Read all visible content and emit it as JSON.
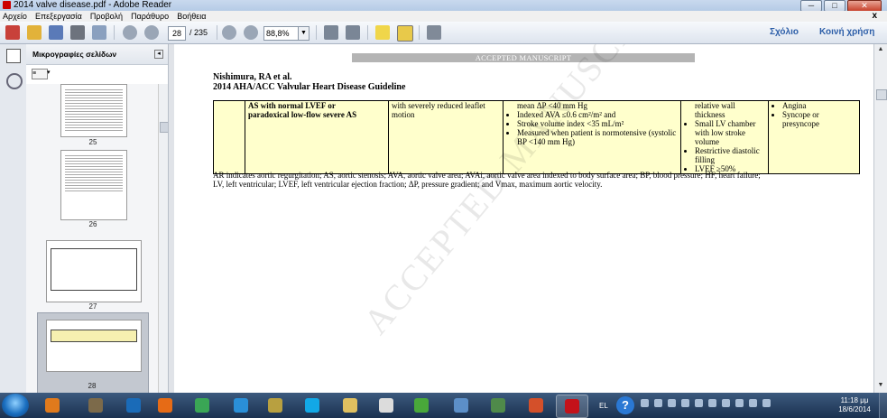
{
  "window": {
    "title": "2014 valve disease.pdf - Adobe Reader",
    "minimize": "─",
    "maximize": "□",
    "close": "✕",
    "doc_close": "x"
  },
  "menu": [
    "Αρχείο",
    "Επεξεργασία",
    "Προβολή",
    "Παράθυρο",
    "Βοήθεια"
  ],
  "toolbar": {
    "page_number": "28",
    "page_total": "/ 235",
    "zoom": "88,8%",
    "comment_link": "Σχόλιο",
    "share_link": "Κοινή χρήση"
  },
  "sidebar": {
    "title": "Μικρογραφίες σελίδων",
    "thumbnails": [
      {
        "label": "25"
      },
      {
        "label": "26"
      },
      {
        "label": "27"
      },
      {
        "label": "28"
      }
    ]
  },
  "document": {
    "banner": "ACCEPTED MANUSCRIPT",
    "author": "Nishimura, RA et al.",
    "guideline": "2014 AHA/ACC Valvular Heart Disease Guideline",
    "table_row": {
      "c2_line1": "AS with normal LVEF or",
      "c2_line2": "paradoxical low-flow severe AS",
      "c3": "with severely reduced leaflet motion",
      "c4_head": "mean ΔP <40 mm Hg",
      "c4_items": [
        "Indexed AVA ≤0.6 cm²/m² and",
        "Stroke volume index <35 mL/m²",
        "Measured when patient is normotensive (systolic BP <140 mm Hg)"
      ],
      "c5_head": "relative wall thickness",
      "c5_items": [
        "Small LV chamber with low stroke volume",
        "Restrictive diastolic filling",
        "LVEF ≥50%"
      ],
      "c6_items": [
        "Angina",
        "Syncope or presyncope"
      ]
    },
    "footnote_line1": "AR indicates aortic regurgitation; AS, aortic stenosis; AVA, aortic valve area; AVAi, aortic valve area indexed to body surface area; BP, blood pressure; HF, heart failure;",
    "footnote_line2": "LV, left ventricular; LVEF, left ventricular ejection fraction; ΔP, pressure gradient; and Vmax, maximum aortic velocity.",
    "watermark": "ACCEPTED MANUSCRIPT"
  },
  "taskbar": {
    "lang": "EL",
    "help": "?",
    "time": "11:18 μμ",
    "date": "18/6/2014",
    "apps": [
      {
        "name": "media-player",
        "color": "#e07a1c"
      },
      {
        "name": "file-manager",
        "color": "#7c6a4a"
      },
      {
        "name": "hp",
        "color": "#1a6bb8"
      },
      {
        "name": "firefox",
        "color": "#e66b16"
      },
      {
        "name": "chrome",
        "color": "#3aa655"
      },
      {
        "name": "internet-explorer",
        "color": "#2a8fd8"
      },
      {
        "name": "office-tool",
        "color": "#b8a040"
      },
      {
        "name": "skype",
        "color": "#12a8e6"
      },
      {
        "name": "explorer",
        "color": "#e0c060"
      },
      {
        "name": "notepad",
        "color": "#dcdcdc"
      },
      {
        "name": "utorrent",
        "color": "#49a83a"
      },
      {
        "name": "settings",
        "color": "#5c8fc8"
      },
      {
        "name": "monitor",
        "color": "#4f8a4a"
      },
      {
        "name": "powerpoint",
        "color": "#d4502a"
      },
      {
        "name": "adobe-reader",
        "color": "#c4121a"
      }
    ]
  }
}
